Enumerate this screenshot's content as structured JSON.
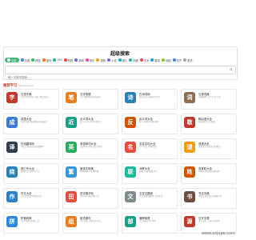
{
  "header": {
    "title": "超级搜索"
  },
  "tabs": [
    {
      "label": "全部",
      "color": "#3cb371",
      "active": true
    },
    {
      "label": "百度",
      "color": "#3b82f6"
    },
    {
      "label": "微信",
      "color": "#22c55e"
    },
    {
      "label": "搜狗",
      "color": "#f97316"
    },
    {
      "label": "360",
      "color": "#10b981"
    },
    {
      "label": "购物",
      "color": "#ef4444"
    },
    {
      "label": "新闻",
      "color": "#6366f1"
    },
    {
      "label": "音乐",
      "color": "#ec4899"
    },
    {
      "label": "视频",
      "color": "#f59e0b"
    },
    {
      "label": "小说",
      "color": "#8b5cf6"
    },
    {
      "label": "图片",
      "color": "#06b6d4"
    },
    {
      "label": "网盘",
      "color": "#14b8a6"
    },
    {
      "label": "学术",
      "color": "#f43f5e"
    },
    {
      "label": "翻译",
      "color": "#0ea5e9"
    },
    {
      "label": "地图",
      "color": "#84cc16"
    },
    {
      "label": "知乎",
      "color": "#3b82f6"
    },
    {
      "label": "更多",
      "color": "#9ca3af"
    }
  ],
  "search": {
    "placeholder": "输入关键词搜索..."
  },
  "section": {
    "heading": "推荐学习",
    "subheading": "Recommend"
  },
  "cards": [
    {
      "name": "汉语字典",
      "desc": "汉字查询 拼音 部首 笔画 组词",
      "color": "#c0392b",
      "glyph": "字"
    },
    {
      "name": "汉字笔顺",
      "desc": "汉字笔顺笔画动画演示",
      "color": "#e67e22",
      "glyph": "笔"
    },
    {
      "name": "古诗词网",
      "desc": "唐诗宋词元曲古文大全",
      "color": "#2980b9",
      "glyph": "诗"
    },
    {
      "name": "汉语词典",
      "desc": "词语解释 近义词 反义词",
      "color": "#8e6e53",
      "glyph": "词"
    },
    {
      "name": "成语大全",
      "desc": "成语词典 成语故事 成语接龙",
      "color": "#3a7bd5",
      "glyph": "成"
    },
    {
      "name": "近义词大全",
      "desc": "近义词 同义词查询大全",
      "color": "#16a085",
      "glyph": "近"
    },
    {
      "name": "反义词大全",
      "desc": "反义词查询 词语对照",
      "color": "#d35400",
      "glyph": "反"
    },
    {
      "name": "歇后语大全",
      "desc": "歇后语大全及答案",
      "color": "#c0392b",
      "glyph": "歇"
    },
    {
      "name": "在线翻译网",
      "desc": "中英日韩多语言在线翻译",
      "color": "#2c3e50",
      "glyph": "译"
    },
    {
      "name": "英语单词大全",
      "desc": "英语单词查询 发音 例句",
      "color": "#27ae60",
      "glyph": "英"
    },
    {
      "name": "名言名句大全",
      "desc": "名人名言 经典语录",
      "color": "#e74c3c",
      "glyph": "名"
    },
    {
      "name": "谜语大全",
      "desc": "谜语大全及答案 猜谜语",
      "color": "#f39c12",
      "glyph": "谜"
    },
    {
      "name": "绕口令大全",
      "desc": "经典绕口令练习大全",
      "color": "#2980b9",
      "glyph": "绕"
    },
    {
      "name": "繁体字转换",
      "desc": "简体繁体字在线转换",
      "color": "#3498db",
      "glyph": "繁"
    },
    {
      "name": "对联大全",
      "desc": "春联 对联 横批大全",
      "color": "#1abc9c",
      "glyph": "联"
    },
    {
      "name": "百家姓大全",
      "desc": "中国姓氏来源起源查询",
      "color": "#d35400",
      "glyph": "姓"
    },
    {
      "name": "作文大全",
      "desc": "小学初中高中作文范文",
      "color": "#2c82c9",
      "glyph": "作"
    },
    {
      "name": "田字格字帖",
      "desc": "田字格字帖生成打印",
      "color": "#e74c3c",
      "glyph": "田"
    },
    {
      "name": "文言文翻译",
      "desc": "文言文在线翻译 古文译注",
      "color": "#7f8c8d",
      "glyph": "文"
    },
    {
      "name": "书法字典",
      "desc": "书法字体查询 篆隶楷行草",
      "color": "#6d4c41",
      "glyph": "书"
    },
    {
      "name": "拼音转换",
      "desc": "汉字转拼音在线工具",
      "color": "#2e86de",
      "glyph": "拼"
    },
    {
      "name": "组词造句",
      "desc": "汉字组词 词语造句大全",
      "color": "#e67e22",
      "glyph": "组"
    },
    {
      "name": "偏旁部首",
      "desc": "汉字偏旁部首查询",
      "color": "#16a085",
      "glyph": "部"
    },
    {
      "name": "汉字字源",
      "desc": "汉字演变 字源字形查询",
      "color": "#c0392b",
      "glyph": "源"
    }
  ],
  "watermark": "www.ezjupe.com"
}
